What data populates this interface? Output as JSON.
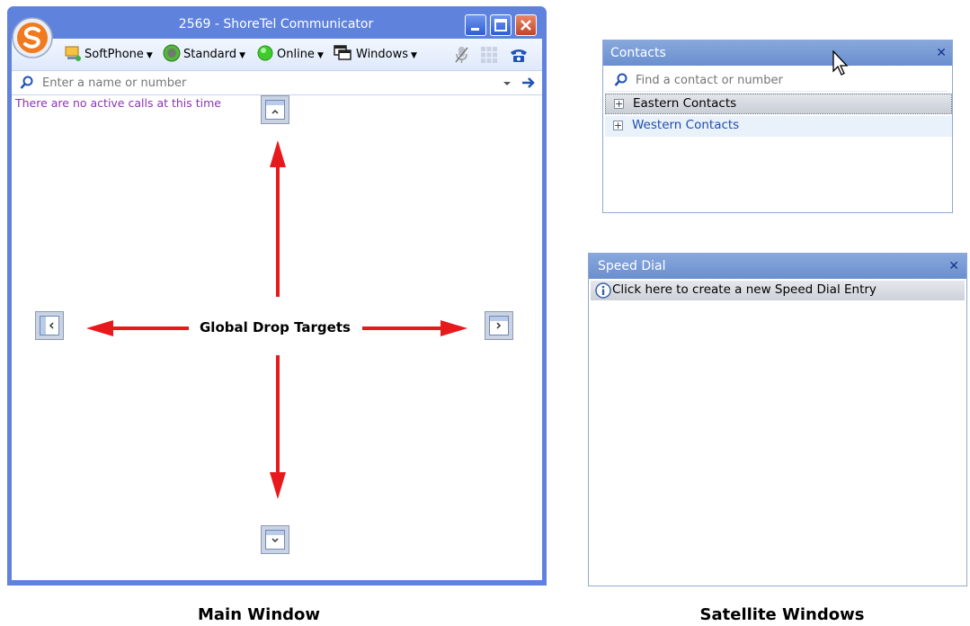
{
  "main_window": {
    "title": "2569 - ShoreTel Communicator",
    "toolbar": {
      "softphone": "SoftPhone",
      "standard": "Standard",
      "online": "Online",
      "windows": "Windows"
    },
    "search": {
      "placeholder": "Enter a name or number"
    },
    "status_message": "There are no active calls at this time",
    "drop_targets_label": "Global Drop Targets"
  },
  "contacts_panel": {
    "title": "Contacts",
    "search_placeholder": "Find a contact or number",
    "groups": [
      {
        "label": "Eastern Contacts"
      },
      {
        "label": "Western Contacts"
      }
    ]
  },
  "speed_dial_panel": {
    "title": "Speed Dial",
    "create_entry": "Click here to create a new Speed Dial Entry"
  },
  "captions": {
    "main": "Main Window",
    "satellite": "Satellite Windows"
  },
  "colors": {
    "title_bar": "#5f82dc",
    "status_text": "#8b34b8",
    "arrow": "#e8191c",
    "panel_header": "#7196d3"
  }
}
